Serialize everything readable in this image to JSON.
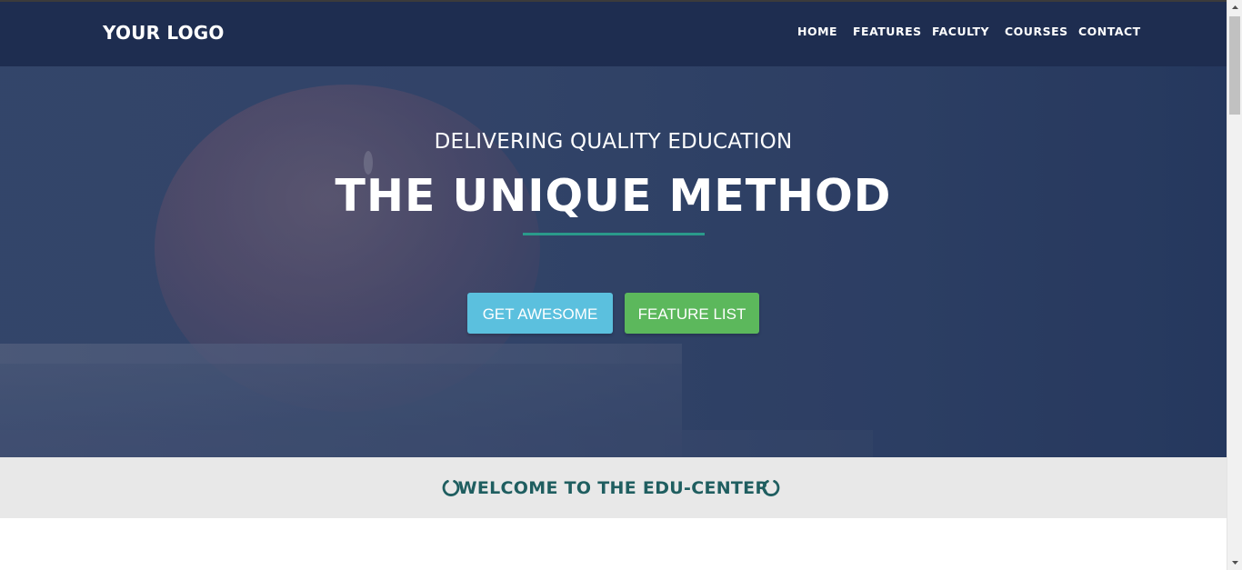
{
  "navbar": {
    "logo": "YOUR LOGO",
    "links": [
      {
        "label": "HOME"
      },
      {
        "label": "FEATURES"
      },
      {
        "label": "FACULTY"
      },
      {
        "label": "COURSES"
      },
      {
        "label": "CONTACT"
      }
    ]
  },
  "hero": {
    "subtitle": "DELIVERING QUALITY EDUCATION",
    "title": "THE UNIQUE METHOD",
    "buttons": {
      "primary": "GET AWESOME",
      "secondary": "FEATURE LIST"
    }
  },
  "welcome": {
    "title": "WELCOME TO THE EDU-CENTER",
    "icon": "circle-notch-icon"
  },
  "colors": {
    "navbar_bg": "#1e2d50",
    "accent_divider": "#2a9a8b",
    "button_info": "#5bc0de",
    "button_success": "#5cb85c",
    "welcome_text": "#1f5e60"
  }
}
